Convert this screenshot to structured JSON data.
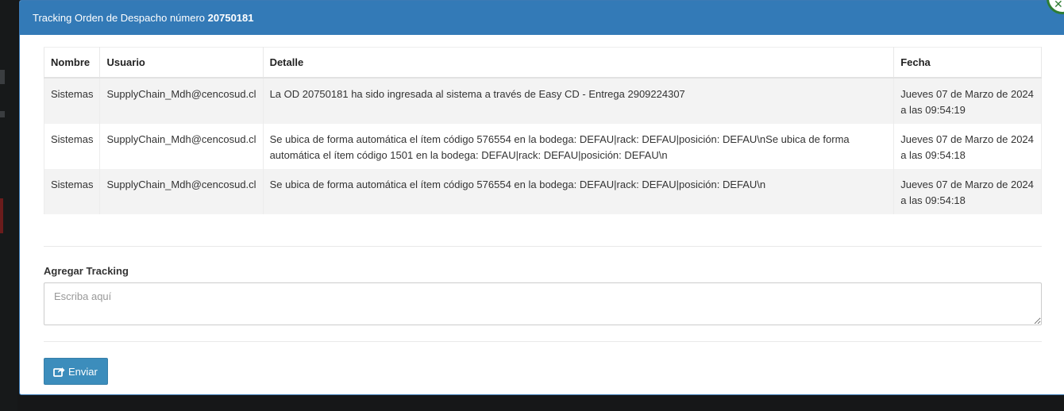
{
  "modal": {
    "title_prefix": "Tracking Orden de Despacho número",
    "order_number": "20750181"
  },
  "table": {
    "headers": {
      "nombre": "Nombre",
      "usuario": "Usuario",
      "detalle": "Detalle",
      "fecha": "Fecha"
    },
    "rows": [
      {
        "nombre": "Sistemas",
        "usuario": "SupplyChain_Mdh@cencosud.cl",
        "detalle": "La OD 20750181 ha sido ingresada al sistema a través de Easy CD - Entrega 2909224307",
        "fecha_line1": "Jueves 07 de Marzo de 2024",
        "fecha_line2": "a las 09:54:19"
      },
      {
        "nombre": "Sistemas",
        "usuario": "SupplyChain_Mdh@cencosud.cl",
        "detalle_line1": "Se ubica de forma automática el ítem código 576554 en la bodega: DEFAU|rack: DEFAU|posición: DEFAU\\nSe ubica de forma",
        "detalle_line2": "automática el ítem código 1501 en la bodega: DEFAU|rack: DEFAU|posición: DEFAU\\n",
        "fecha_line1": "Jueves 07 de Marzo de 2024",
        "fecha_line2": "a las 09:54:18"
      },
      {
        "nombre": "Sistemas",
        "usuario": "SupplyChain_Mdh@cencosud.cl",
        "detalle": "Se ubica de forma automática el ítem código 576554 en la bodega: DEFAU|rack: DEFAU|posición: DEFAU\\n",
        "fecha_line1": "Jueves 07 de Marzo de 2024",
        "fecha_line2": "a las 09:54:18"
      }
    ]
  },
  "form": {
    "label": "Agregar Tracking",
    "placeholder": "Escriba aquí",
    "value": "",
    "submit_label": "Enviar",
    "submit_icon": "share-square-icon"
  },
  "colors": {
    "header_bg": "#337ab7",
    "button_bg": "#3c8dbc",
    "striped_row": "#f3f3f3"
  }
}
